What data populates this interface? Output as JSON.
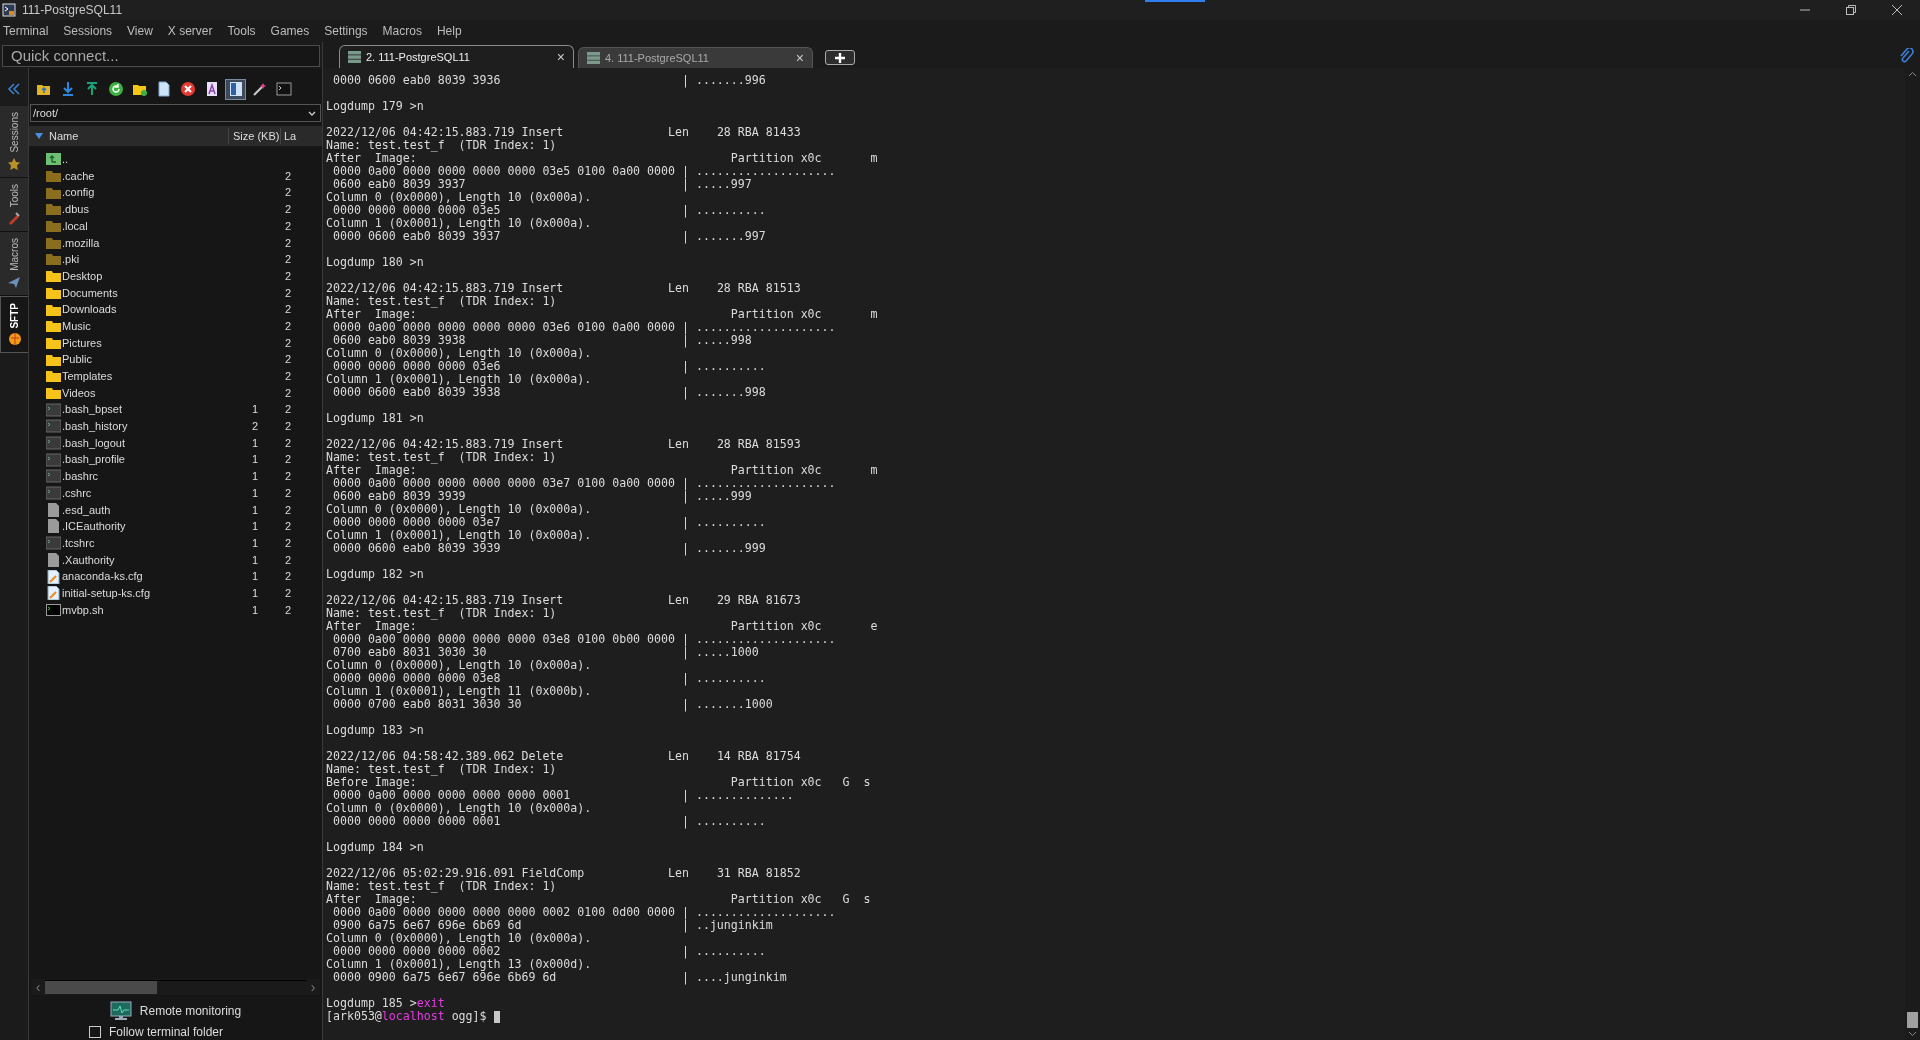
{
  "window": {
    "title": "111-PostgreSQL11"
  },
  "menu": [
    "Terminal",
    "Sessions",
    "View",
    "X server",
    "Tools",
    "Games",
    "Settings",
    "Macros",
    "Help"
  ],
  "quick_connect": {
    "placeholder": "Quick connect..."
  },
  "tabs": [
    {
      "label": "2. 111-PostgreSQL11",
      "selected": true,
      "close": "×"
    },
    {
      "label": "4. 111-PostgreSQL11",
      "selected": false,
      "close": "×"
    }
  ],
  "side_tabs": [
    {
      "label": "Sessions",
      "selected": false
    },
    {
      "label": "Tools",
      "selected": false
    },
    {
      "label": "Macros",
      "selected": false
    },
    {
      "label": "SFTP",
      "selected": true
    }
  ],
  "sftp": {
    "toolbar": [
      {
        "kind": "up",
        "selected": false
      },
      {
        "kind": "download",
        "selected": false
      },
      {
        "kind": "upload",
        "selected": false
      },
      {
        "kind": "refresh",
        "selected": false
      },
      {
        "kind": "newfolder",
        "selected": false
      },
      {
        "kind": "newfile",
        "selected": false
      },
      {
        "kind": "delete",
        "selected": false
      },
      {
        "kind": "text",
        "selected": false
      },
      {
        "kind": "split",
        "selected": true
      },
      {
        "kind": "wand",
        "selected": false
      },
      {
        "kind": "terminal",
        "selected": false
      }
    ],
    "path": "/root/",
    "columns": [
      "Name",
      "Size (KB)",
      "La"
    ],
    "files": [
      {
        "kind": "up",
        "name": ".."
      },
      {
        "kind": "dotfolder",
        "name": ".cache",
        "modified": "2"
      },
      {
        "kind": "dotfolder",
        "name": ".config",
        "modified": "2"
      },
      {
        "kind": "dotfolder",
        "name": ".dbus",
        "modified": "2"
      },
      {
        "kind": "dotfolder",
        "name": ".local",
        "modified": "2"
      },
      {
        "kind": "dotfolder",
        "name": ".mozilla",
        "modified": "2"
      },
      {
        "kind": "dotfolder",
        "name": ".pki",
        "modified": "2"
      },
      {
        "kind": "folder",
        "name": "Desktop",
        "modified": "2"
      },
      {
        "kind": "folder",
        "name": "Documents",
        "modified": "2"
      },
      {
        "kind": "folder",
        "name": "Downloads",
        "modified": "2"
      },
      {
        "kind": "folder",
        "name": "Music",
        "modified": "2"
      },
      {
        "kind": "folder",
        "name": "Pictures",
        "modified": "2"
      },
      {
        "kind": "folder",
        "name": "Public",
        "modified": "2"
      },
      {
        "kind": "folder",
        "name": "Templates",
        "modified": "2"
      },
      {
        "kind": "folder",
        "name": "Videos",
        "modified": "2"
      },
      {
        "kind": "script",
        "name": ".bash_bpset",
        "size": "1",
        "modified": "2"
      },
      {
        "kind": "script",
        "name": ".bash_history",
        "size": "2",
        "modified": "2"
      },
      {
        "kind": "script",
        "name": ".bash_logout",
        "size": "1",
        "modified": "2"
      },
      {
        "kind": "script",
        "name": ".bash_profile",
        "size": "1",
        "modified": "2"
      },
      {
        "kind": "script",
        "name": ".bashrc",
        "size": "1",
        "modified": "2"
      },
      {
        "kind": "script",
        "name": ".cshrc",
        "size": "1",
        "modified": "2"
      },
      {
        "kind": "file",
        "name": ".esd_auth",
        "size": "1",
        "modified": "2"
      },
      {
        "kind": "file",
        "name": ".ICEauthority",
        "size": "1",
        "modified": "2"
      },
      {
        "kind": "script",
        "name": ".tcshrc",
        "size": "1",
        "modified": "2"
      },
      {
        "kind": "file",
        "name": ".Xauthority",
        "size": "1",
        "modified": "2"
      },
      {
        "kind": "cfg",
        "name": "anaconda-ks.cfg",
        "size": "1",
        "modified": "2"
      },
      {
        "kind": "cfg",
        "name": "initial-setup-ks.cfg",
        "size": "1",
        "modified": "2"
      },
      {
        "kind": "exec",
        "name": "mvbp.sh",
        "size": "1",
        "modified": "2"
      }
    ],
    "scroll_left": "‹",
    "scroll_right": "›",
    "remote_monitoring": "Remote monitoring",
    "follow_terminal_folder": {
      "label": "Follow terminal folder",
      "checked": false
    }
  },
  "terminal": {
    "lines": [
      {
        "kind": "dump",
        "hex": " 0000 0600 eab0 8039 3936",
        "ascii": "| .......996"
      },
      {
        "kind": "blank"
      },
      {
        "kind": "text",
        "text": "Logdump 179 >n"
      },
      {
        "kind": "blank"
      },
      {
        "kind": "record",
        "event": "2022/12/06 04:42:15.883.719 Insert",
        "length": "Len    28 RBA 81433"
      },
      {
        "kind": "text",
        "text": "Name: test.test_f  (TDR Index: 1)"
      },
      {
        "kind": "image",
        "label": "After  Image:",
        "partition": "Partition x0c       m"
      },
      {
        "kind": "dump",
        "hex": " 0000 0a00 0000 0000 0000 0000 03e5 0100 0a00 0000",
        "ascii": "| ...................."
      },
      {
        "kind": "dump",
        "hex": " 0600 eab0 8039 3937",
        "ascii": "| .....997"
      },
      {
        "kind": "text",
        "text": "Column 0 (0x0000), Length 10 (0x000a)."
      },
      {
        "kind": "dump",
        "hex": " 0000 0000 0000 0000 03e5",
        "ascii": "| .........."
      },
      {
        "kind": "text",
        "text": "Column 1 (0x0001), Length 10 (0x000a)."
      },
      {
        "kind": "dump",
        "hex": " 0000 0600 eab0 8039 3937",
        "ascii": "| .......997"
      },
      {
        "kind": "blank"
      },
      {
        "kind": "text",
        "text": "Logdump 180 >n"
      },
      {
        "kind": "blank"
      },
      {
        "kind": "record",
        "event": "2022/12/06 04:42:15.883.719 Insert",
        "length": "Len    28 RBA 81513"
      },
      {
        "kind": "text",
        "text": "Name: test.test_f  (TDR Index: 1)"
      },
      {
        "kind": "image",
        "label": "After  Image:",
        "partition": "Partition x0c       m"
      },
      {
        "kind": "dump",
        "hex": " 0000 0a00 0000 0000 0000 0000 03e6 0100 0a00 0000",
        "ascii": "| ...................."
      },
      {
        "kind": "dump",
        "hex": " 0600 eab0 8039 3938",
        "ascii": "| .....998"
      },
      {
        "kind": "text",
        "text": "Column 0 (0x0000), Length 10 (0x000a)."
      },
      {
        "kind": "dump",
        "hex": " 0000 0000 0000 0000 03e6",
        "ascii": "| .........."
      },
      {
        "kind": "text",
        "text": "Column 1 (0x0001), Length 10 (0x000a)."
      },
      {
        "kind": "dump",
        "hex": " 0000 0600 eab0 8039 3938",
        "ascii": "| .......998"
      },
      {
        "kind": "blank"
      },
      {
        "kind": "text",
        "text": "Logdump 181 >n"
      },
      {
        "kind": "blank"
      },
      {
        "kind": "record",
        "event": "2022/12/06 04:42:15.883.719 Insert",
        "length": "Len    28 RBA 81593"
      },
      {
        "kind": "text",
        "text": "Name: test.test_f  (TDR Index: 1)"
      },
      {
        "kind": "image",
        "label": "After  Image:",
        "partition": "Partition x0c       m"
      },
      {
        "kind": "dump",
        "hex": " 0000 0a00 0000 0000 0000 0000 03e7 0100 0a00 0000",
        "ascii": "| ...................."
      },
      {
        "kind": "dump",
        "hex": " 0600 eab0 8039 3939",
        "ascii": "| .....999"
      },
      {
        "kind": "text",
        "text": "Column 0 (0x0000), Length 10 (0x000a)."
      },
      {
        "kind": "dump",
        "hex": " 0000 0000 0000 0000 03e7",
        "ascii": "| .........."
      },
      {
        "kind": "text",
        "text": "Column 1 (0x0001), Length 10 (0x000a)."
      },
      {
        "kind": "dump",
        "hex": " 0000 0600 eab0 8039 3939",
        "ascii": "| .......999"
      },
      {
        "kind": "blank"
      },
      {
        "kind": "text",
        "text": "Logdump 182 >n"
      },
      {
        "kind": "blank"
      },
      {
        "kind": "record",
        "event": "2022/12/06 04:42:15.883.719 Insert",
        "length": "Len    29 RBA 81673"
      },
      {
        "kind": "text",
        "text": "Name: test.test_f  (TDR Index: 1)"
      },
      {
        "kind": "image",
        "label": "After  Image:",
        "partition": "Partition x0c       e"
      },
      {
        "kind": "dump",
        "hex": " 0000 0a00 0000 0000 0000 0000 03e8 0100 0b00 0000",
        "ascii": "| ...................."
      },
      {
        "kind": "dump",
        "hex": " 0700 eab0 8031 3030 30",
        "ascii": "| .....1000"
      },
      {
        "kind": "text",
        "text": "Column 0 (0x0000), Length 10 (0x000a)."
      },
      {
        "kind": "dump",
        "hex": " 0000 0000 0000 0000 03e8",
        "ascii": "| .........."
      },
      {
        "kind": "text",
        "text": "Column 1 (0x0001), Length 11 (0x000b)."
      },
      {
        "kind": "dump",
        "hex": " 0000 0700 eab0 8031 3030 30",
        "ascii": "| .......1000"
      },
      {
        "kind": "blank"
      },
      {
        "kind": "text",
        "text": "Logdump 183 >n"
      },
      {
        "kind": "blank"
      },
      {
        "kind": "record",
        "event": "2022/12/06 04:58:42.389.062 Delete",
        "length": "Len    14 RBA 81754"
      },
      {
        "kind": "text",
        "text": "Name: test.test_f  (TDR Index: 1)"
      },
      {
        "kind": "image",
        "label": "Before Image:",
        "partition": "Partition x0c   G  s"
      },
      {
        "kind": "dump",
        "hex": " 0000 0a00 0000 0000 0000 0000 0001",
        "ascii": "| .............."
      },
      {
        "kind": "text",
        "text": "Column 0 (0x0000), Length 10 (0x000a)."
      },
      {
        "kind": "dump",
        "hex": " 0000 0000 0000 0000 0001",
        "ascii": "| .........."
      },
      {
        "kind": "blank"
      },
      {
        "kind": "text",
        "text": "Logdump 184 >n"
      },
      {
        "kind": "blank"
      },
      {
        "kind": "record",
        "event": "2022/12/06 05:02:29.916.091 FieldComp",
        "length": "Len    31 RBA 81852"
      },
      {
        "kind": "text",
        "text": "Name: test.test_f  (TDR Index: 1)"
      },
      {
        "kind": "image",
        "label": "After  Image:",
        "partition": "Partition x0c   G  s"
      },
      {
        "kind": "dump",
        "hex": " 0000 0a00 0000 0000 0000 0000 0002 0100 0d00 0000",
        "ascii": "| ...................."
      },
      {
        "kind": "dump",
        "hex": " 0900 6a75 6e67 696e 6b69 6d",
        "ascii": "| ..junginkim"
      },
      {
        "kind": "text",
        "text": "Column 0 (0x0000), Length 10 (0x000a)."
      },
      {
        "kind": "dump",
        "hex": " 0000 0000 0000 0000 0002",
        "ascii": "| .........."
      },
      {
        "kind": "text",
        "text": "Column 1 (0x0001), Length 13 (0x000d)."
      },
      {
        "kind": "dump",
        "hex": " 0000 0900 6a75 6e67 696e 6b69 6d",
        "ascii": "| ....junginkim"
      },
      {
        "kind": "blank"
      },
      {
        "kind": "command",
        "prompt": "Logdump 185 >",
        "command": "exit"
      },
      {
        "kind": "shell",
        "user": "[ark053@",
        "host": "localhost",
        "path": "ogg]$"
      }
    ]
  }
}
